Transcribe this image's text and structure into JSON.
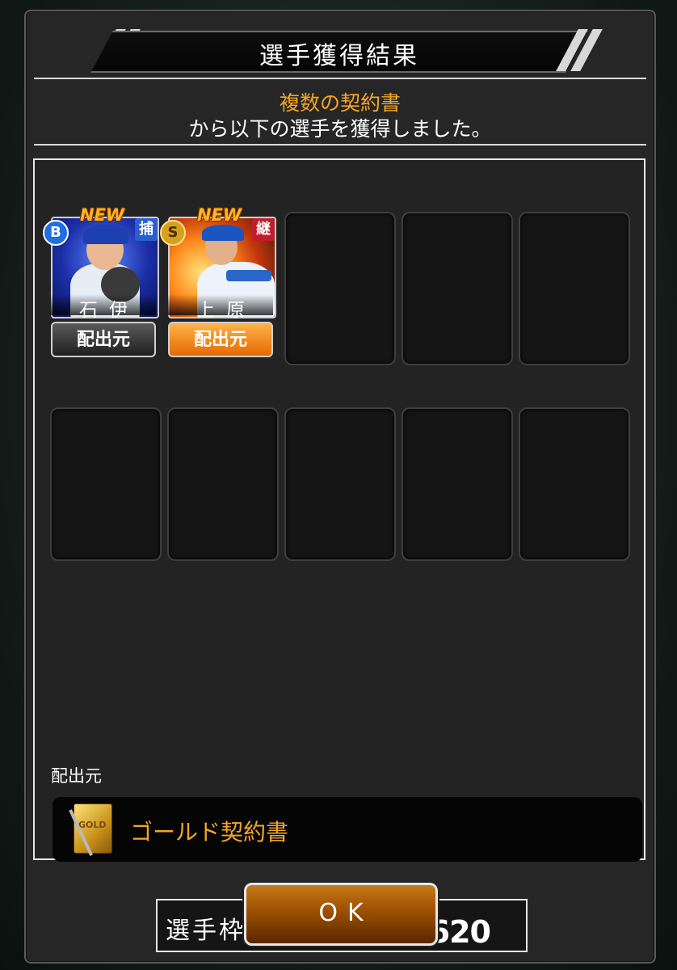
{
  "dialog": {
    "title": "選手獲得結果",
    "message_highlight": "複数の契約書",
    "message_text": "から以下の選手を獲得しました。"
  },
  "players": [
    {
      "new_label": "NEW",
      "rank": "B",
      "position": "捕",
      "name": "石伊",
      "source_button": "配出元",
      "source_button_style": "gray"
    },
    {
      "new_label": "NEW",
      "rank": "S",
      "position": "継",
      "name": "上原",
      "source_button": "配出元",
      "source_button_style": "orange"
    }
  ],
  "empty_slots": 8,
  "source_section": {
    "label": "配出元",
    "item_name": "ゴールド契約書",
    "item_icon": "gold-contract-icon",
    "icon_text": "GOLD"
  },
  "capacity": {
    "label": "選手枠：",
    "value": "535／620"
  },
  "ok_button": "OK",
  "colors": {
    "accent_orange": "#f5a623",
    "rank_b": "#1e6fe0",
    "rank_s": "#d5a01c",
    "position_catcher": "#2a5fd0",
    "position_relief": "#c21d2c"
  }
}
